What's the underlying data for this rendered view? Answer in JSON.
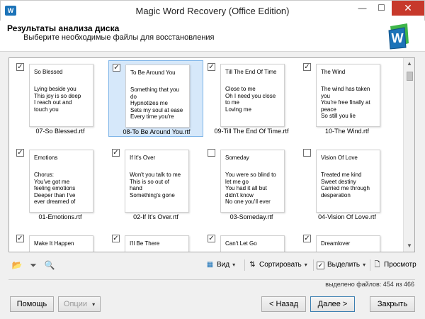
{
  "window": {
    "title": "Magic Word Recovery (Office Edition)",
    "app_icon_label": "W",
    "min_glyph": "—",
    "max_glyph": "☐",
    "close_glyph": "✕"
  },
  "header": {
    "title": "Результаты анализа диска",
    "subtitle": "Выберите необходимые файлы для восстановления",
    "logo_icon": "magic-word-logo-icon",
    "logo_letter": "W"
  },
  "files": [
    {
      "checked": true,
      "selected": false,
      "page_title": "So Blessed",
      "page_body": "Lying beside you\nThis joy is so deep\nI reach out and\ntouch you",
      "name": "07-So Blessed.rtf"
    },
    {
      "checked": true,
      "selected": true,
      "page_title": "To Be Around You",
      "page_body": "Something that you\ndo\nHypnotizes me\nSets my soul at ease\nEvery time you're",
      "name": "08-To Be Around You.rtf"
    },
    {
      "checked": true,
      "selected": false,
      "page_title": "Till The End Of Time",
      "page_body": "Close to me\nOh I need you close\nto me\nLoving me",
      "name": "09-Till The End Of Time.rtf"
    },
    {
      "checked": true,
      "selected": false,
      "page_title": "The Wind",
      "page_body": "The wind has taken\nyou\nYou're free finally at\npeace\nSo still you lie",
      "name": "10-The Wind.rtf"
    },
    {
      "checked": true,
      "selected": false,
      "page_title": "Emotions",
      "page_body": "Chorus:\nYou've got me\nfeeling emotions\nDeeper than I've\never dreamed of",
      "name": "01-Emotions.rtf"
    },
    {
      "checked": true,
      "selected": false,
      "page_title": "If It's Over",
      "page_body": "Won't you talk to me\nThis is so out of\nhand\nSomething's gone",
      "name": "02-If It's Over.rtf"
    },
    {
      "checked": false,
      "selected": false,
      "page_title": "Someday",
      "page_body": "You were so blind to\nlet me go\nYou had it all but\ndidn't know\nNo one you'll ever",
      "name": "03-Someday.rtf"
    },
    {
      "checked": false,
      "selected": false,
      "page_title": "Vision Of Love",
      "page_body": "Treated me kind\nSweet destiny\nCarried me through\ndesperation",
      "name": "04-Vision Of Love.rtf"
    },
    {
      "checked": true,
      "selected": false,
      "page_title": "Make It Happen",
      "page_body": "",
      "name": ""
    },
    {
      "checked": true,
      "selected": false,
      "page_title": "I'll Be There",
      "page_body": "",
      "name": ""
    },
    {
      "checked": true,
      "selected": false,
      "page_title": "Can't Let Go",
      "page_body": "",
      "name": ""
    },
    {
      "checked": true,
      "selected": false,
      "page_title": "Dreamlover",
      "page_body": "",
      "name": ""
    }
  ],
  "scrollbar": {
    "up_glyph": "▲",
    "down_glyph": "▼"
  },
  "toolbar": {
    "folder_icon": "folder-icon",
    "filter_icon": "filter-icon",
    "search_icon": "search-icon",
    "view_label": "Вид",
    "sort_label": "Сортировать",
    "select_label": "Выделить",
    "preview_label": "Просмотр",
    "dropdown_glyph": "▾",
    "check_glyph": "✓"
  },
  "status": {
    "text": "выделено файлов: 454 из 466",
    "selected_count": 454,
    "total_count": 466
  },
  "buttons": {
    "help": "Помощь",
    "options": "Опции",
    "back": "< Назад",
    "next": "Далее >",
    "close": "Закрыть"
  },
  "colors": {
    "selection": "#d6e8fa",
    "close_button": "#c7392b",
    "logo_green": "#3fb54a",
    "logo_blue": "#1c73b8"
  }
}
